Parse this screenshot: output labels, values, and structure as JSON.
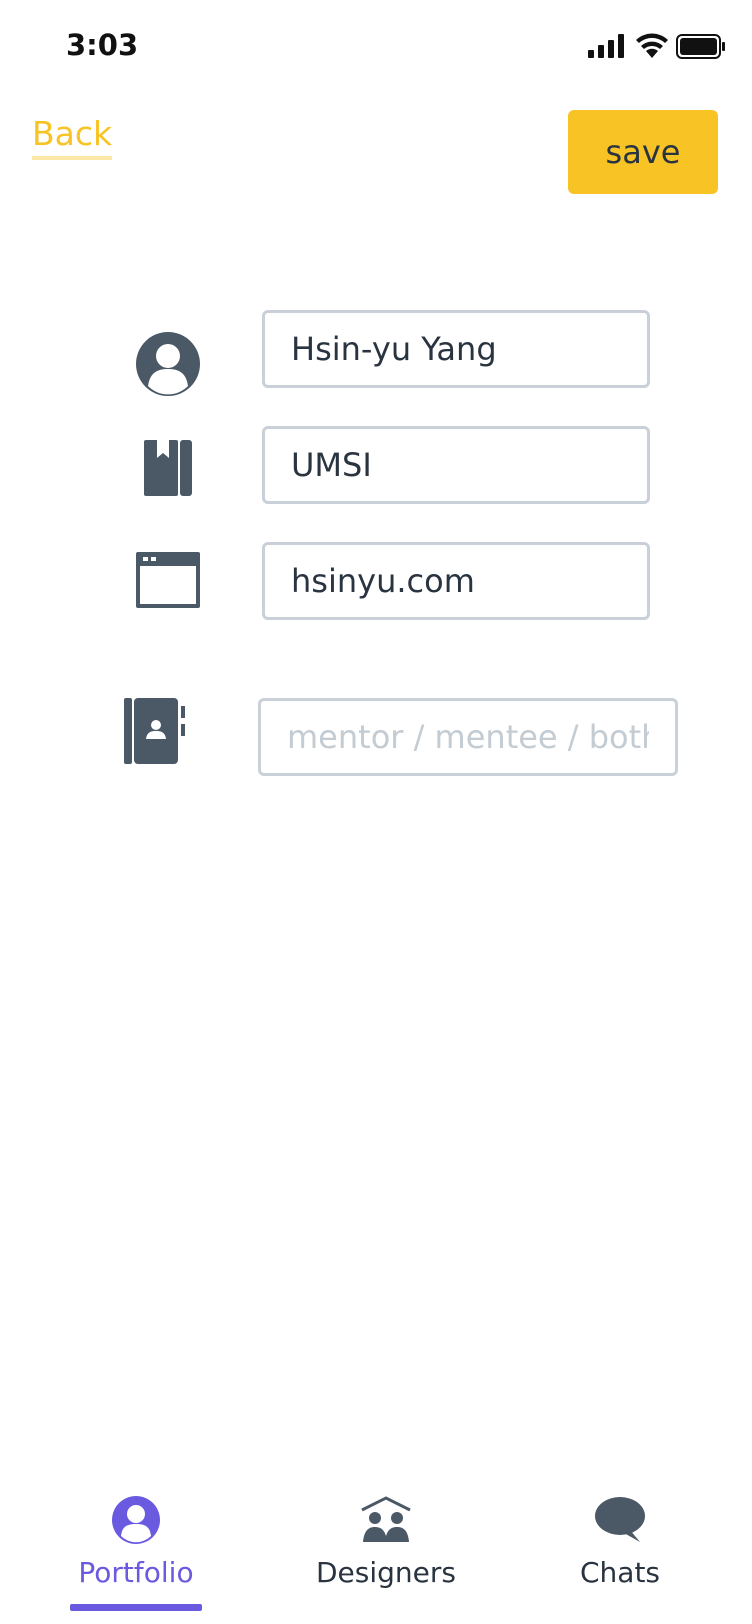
{
  "status": {
    "time": "3:03"
  },
  "header": {
    "back_label": "Back",
    "save_label": "save"
  },
  "form": {
    "name_value": "Hsin-yu Yang",
    "school_value": "UMSI",
    "website_value": "hsinyu.com",
    "role_value": "",
    "role_placeholder": "mentor / mentee / both"
  },
  "tabs": [
    {
      "label": "Portfolio",
      "icon": "user-circle-icon",
      "active": true
    },
    {
      "label": "Designers",
      "icon": "group-icon",
      "active": false
    },
    {
      "label": "Chats",
      "icon": "chat-bubble-icon",
      "active": false
    }
  ],
  "colors": {
    "accent_yellow": "#f7c325",
    "active_tab": "#6a5ae0",
    "icon_slate": "#4b5866",
    "field_border": "#c9d0d8"
  }
}
